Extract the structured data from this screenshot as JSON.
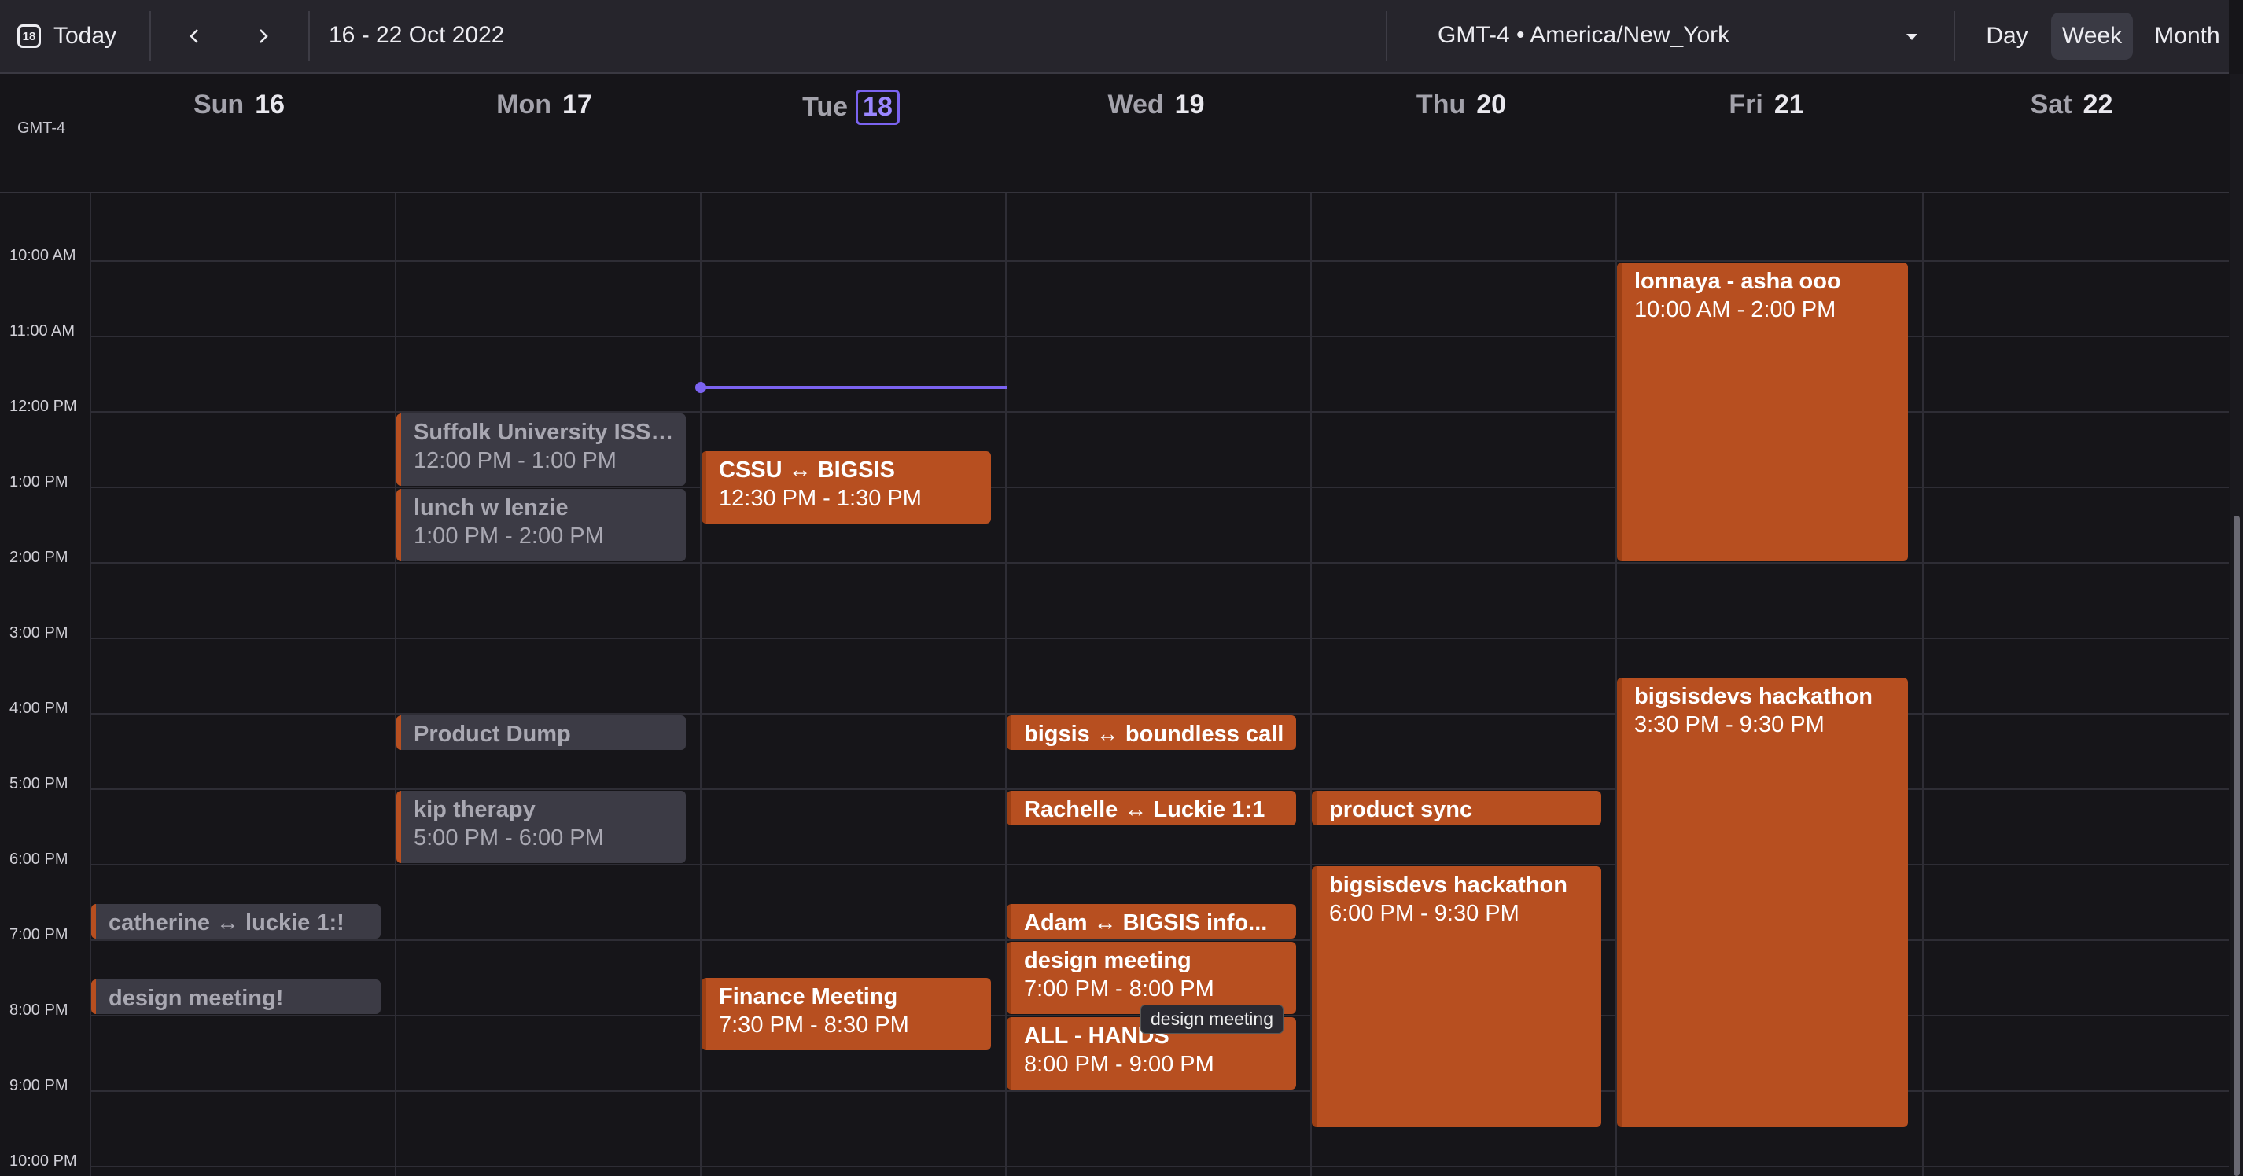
{
  "toolbar": {
    "today_label": "Today",
    "today_icon_num": "18",
    "date_range": "16 - 22 Oct 2022",
    "timezone": "GMT-4 • America/New_York",
    "views": [
      "Day",
      "Week",
      "Month"
    ],
    "active_view": "Week"
  },
  "header": {
    "tz_short": "GMT-4",
    "days": [
      {
        "name": "Sun",
        "num": "16"
      },
      {
        "name": "Mon",
        "num": "17"
      },
      {
        "name": "Tue",
        "num": "18"
      },
      {
        "name": "Wed",
        "num": "19"
      },
      {
        "name": "Thu",
        "num": "20"
      },
      {
        "name": "Fri",
        "num": "21"
      },
      {
        "name": "Sat",
        "num": "22"
      }
    ]
  },
  "times": [
    "10:00 AM",
    "11:00 AM",
    "12:00 PM",
    "1:00 PM",
    "2:00 PM",
    "3:00 PM",
    "4:00 PM",
    "5:00 PM",
    "6:00 PM",
    "7:00 PM",
    "8:00 PM",
    "9:00 PM",
    "10:00 PM"
  ],
  "events": [
    {
      "title": "Suffolk University ISSO...",
      "time": "12:00 PM - 1:00 PM"
    },
    {
      "title": "lunch w lenzie",
      "time": "1:00 PM - 2:00 PM"
    },
    {
      "title": "Product Dump",
      "time": ""
    },
    {
      "title": "kip therapy",
      "time": "5:00 PM - 6:00 PM"
    },
    {
      "title": "catherine ↔ luckie 1:!",
      "time": ""
    },
    {
      "title": "design meeting!",
      "time": ""
    },
    {
      "title": "CSSU ↔ BIGSIS",
      "time": "12:30 PM - 1:30 PM"
    },
    {
      "title": "Finance Meeting",
      "time": "7:30 PM - 8:30 PM"
    },
    {
      "title": "bigsis ↔ boundless call",
      "time": ""
    },
    {
      "title": "Rachelle ↔ Luckie 1:1",
      "time": ""
    },
    {
      "title": "Adam ↔ BIGSIS info...",
      "time": ""
    },
    {
      "title": "design meeting",
      "time": "7:00 PM - 8:00 PM"
    },
    {
      "title": "ALL - HANDS",
      "time": "8:00 PM - 9:00 PM"
    },
    {
      "title": "product sync",
      "time": ""
    },
    {
      "title": "bigsisdevs hackathon",
      "time": "6:00 PM - 9:30 PM"
    },
    {
      "title": "lonnaya - asha ooo",
      "time": "10:00 AM - 2:00 PM"
    },
    {
      "title": "bigsisdevs hackathon",
      "time": "3:30 PM - 9:30 PM"
    }
  ],
  "tooltip": "design meeting",
  "colors": {
    "accent": "#7b63f0",
    "event_orange": "#b74f20",
    "event_gray": "#3c3b45"
  }
}
